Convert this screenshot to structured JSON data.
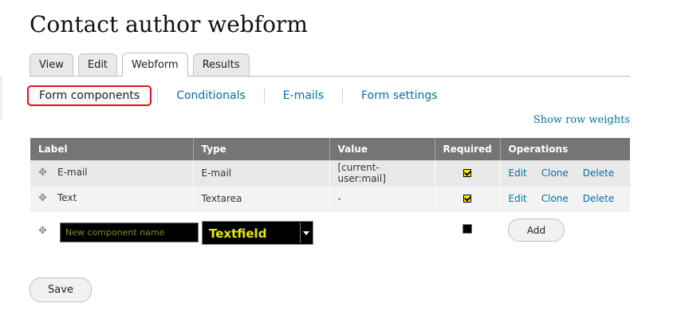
{
  "page": {
    "title": "Contact author webform"
  },
  "tabs": [
    {
      "label": "View"
    },
    {
      "label": "Edit"
    },
    {
      "label": "Webform"
    },
    {
      "label": "Results"
    }
  ],
  "subtabs": [
    {
      "label": "Form components"
    },
    {
      "label": "Conditionals"
    },
    {
      "label": "E-mails"
    },
    {
      "label": "Form settings"
    }
  ],
  "show_row_weights": "Show row weights",
  "table": {
    "headers": [
      "Label",
      "Type",
      "Value",
      "Required",
      "Operations"
    ],
    "rows": [
      {
        "label": "E-mail",
        "type": "E-mail",
        "value": "[current-user:mail]",
        "required": true,
        "ops": [
          "Edit",
          "Clone",
          "Delete"
        ]
      },
      {
        "label": "Text",
        "type": "Textarea",
        "value": "-",
        "required": true,
        "ops": [
          "Edit",
          "Clone",
          "Delete"
        ]
      }
    ]
  },
  "new_component": {
    "name_placeholder": "New component name",
    "type_value": "Textfield",
    "required": false,
    "add_label": "Add"
  },
  "save_label": "Save",
  "icons": {
    "drag": "drag-handle-icon",
    "dropdown": "chevron-down-icon"
  },
  "colors": {
    "link": "#0073a8",
    "header_bg": "#757575",
    "highlight": "#e8101a",
    "checkbox": "#f2f200"
  }
}
